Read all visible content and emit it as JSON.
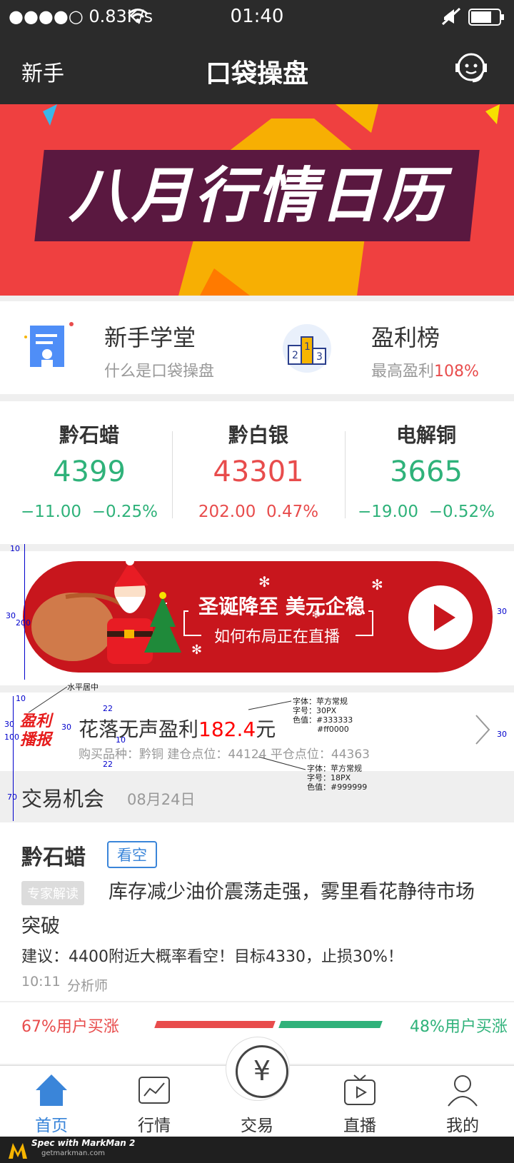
{
  "status": {
    "signal": "●●●●○",
    "speed": "0.83K/s",
    "time": "01:40"
  },
  "nav": {
    "left": "新手",
    "title": "口袋操盘"
  },
  "banner": {
    "text": "八月行情日历"
  },
  "tiles": [
    {
      "title": "新手学堂",
      "sub": "什么是口袋操盘",
      "highlight": ""
    },
    {
      "title": "盈利榜",
      "sub": "最高盈利",
      "highlight": "108%"
    }
  ],
  "quotes": [
    {
      "name": "黔石蜡",
      "price": "4399",
      "change": "−11.00",
      "pct": "−0.25%",
      "color": "#2fb27a"
    },
    {
      "name": "黔白银",
      "price": "43301",
      "change": "202.00",
      "pct": "0.47%",
      "color": "#e84c4c"
    },
    {
      "name": "电解铜",
      "price": "3665",
      "change": "−19.00",
      "pct": "−0.52%",
      "color": "#2fb27a"
    }
  ],
  "live": {
    "line1": "圣诞降至 美元企稳",
    "line2": "如何布局正在直播"
  },
  "profit": {
    "logo_line1": "盈利",
    "logo_line2": "播报",
    "title": "花落无声盈利",
    "value": "182.4",
    "unit": "元",
    "sub": "购买品种：黔铜 建仓点位：44124 平仓点位：44363"
  },
  "section": {
    "title": "交易机会",
    "date": "08月24日"
  },
  "article": {
    "title": "黔石蜡",
    "tag": "看空",
    "badge": "专家解读",
    "headline": "库存减少油价震荡走强，雾里看花静待市场突破",
    "suggestion": "建议：4400附近大概率看空！目标4330，止损30%！",
    "time": "10:11",
    "author": "分析师"
  },
  "ratio": {
    "left": "67%用户买涨",
    "right": "48%用户买涨"
  },
  "tabs": [
    {
      "label": "首页",
      "active": true
    },
    {
      "label": "行情",
      "active": false
    },
    {
      "label": "交易",
      "active": false
    },
    {
      "label": "直播",
      "active": false
    },
    {
      "label": "我的",
      "active": false
    }
  ],
  "annotations": {
    "center": "水平居中",
    "spec_title": [
      "字体：苹方常规",
      "字号：30PX",
      "色值：#333333",
      "#ff0000"
    ],
    "spec_sub": [
      "字体：苹方常规",
      "字号：18PX",
      "色值：#999999"
    ],
    "dims": [
      "10",
      "30",
      "200",
      "10",
      "30",
      "100",
      "30",
      "22",
      "10",
      "22",
      "70",
      "30",
      "30"
    ]
  },
  "footer": {
    "title": "Spec with MarkMan 2",
    "sub": "getmarkman.com"
  },
  "colors": {
    "up": "#e84c4c",
    "down": "#2fb27a",
    "accent": "#3a85d9",
    "navbg": "#2b2b2b"
  },
  "icons": [
    "wifi-icon",
    "mute-icon",
    "battery-icon",
    "customer-service-icon",
    "school-icon",
    "podium-icon",
    "play-icon",
    "chevron-right-icon",
    "home-icon",
    "chart-icon",
    "yen-icon",
    "tv-icon",
    "user-icon"
  ]
}
